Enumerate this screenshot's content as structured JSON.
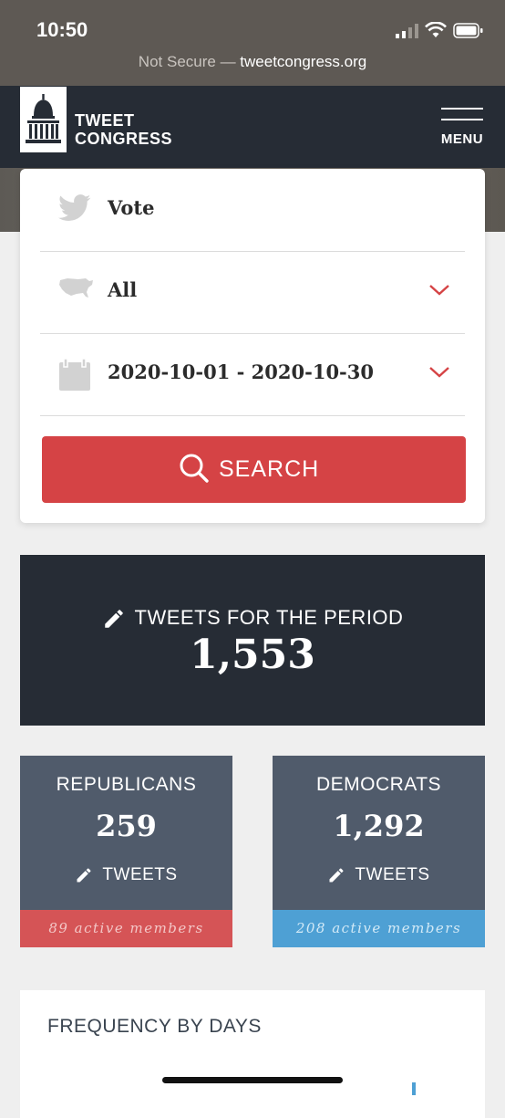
{
  "status": {
    "time": "10:50"
  },
  "browser": {
    "security": "Not Secure",
    "separator": " — ",
    "domain": "tweetcongress.org"
  },
  "header": {
    "brand_line1": "TWEET",
    "brand_line2": "CONGRESS",
    "menu_label": "MENU"
  },
  "search": {
    "keyword": "Vote",
    "state": "All",
    "date_range": "2020-10-01 - 2020-10-30",
    "button_label": "SEARCH"
  },
  "summary": {
    "label": "TWEETS FOR THE PERIOD",
    "value": "1,553"
  },
  "parties": [
    {
      "name": "REPUBLICANS",
      "count": "259",
      "unit": "TWEETS",
      "members": "89 active members",
      "color": "#d55456"
    },
    {
      "name": "DEMOCRATS",
      "count": "1,292",
      "unit": "TWEETS",
      "members": "208 active members",
      "color": "#4ea0d4"
    }
  ],
  "frequency": {
    "title": "FREQUENCY BY DAYS"
  },
  "colors": {
    "navy": "#262c35",
    "accent_red": "#d54345",
    "card_slate": "#505b6b",
    "dem_blue": "#4ea0d4"
  }
}
